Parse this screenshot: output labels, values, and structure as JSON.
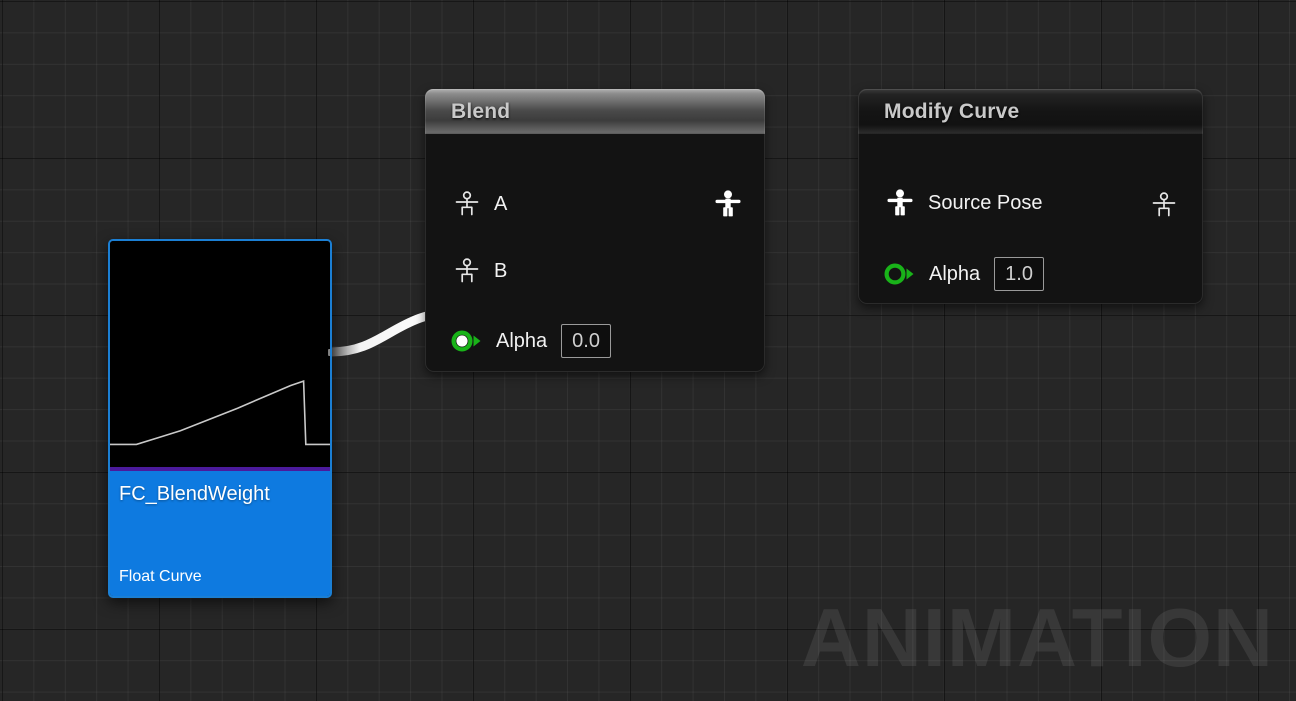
{
  "canvas": {
    "watermark": "ANIMATION",
    "background_color": "#262626",
    "grid_major_color": "#000000",
    "grid_minor_color": "#2f2f2f"
  },
  "nodes": {
    "blend": {
      "title": "Blend",
      "header_style": "light",
      "inputs": [
        {
          "label": "A",
          "pin_type": "pose",
          "connected": false,
          "value": null
        },
        {
          "label": "B",
          "pin_type": "pose",
          "connected": false,
          "value": null
        },
        {
          "label": "Alpha",
          "pin_type": "float",
          "connected": true,
          "value": "0.0"
        }
      ],
      "outputs": [
        {
          "label": "",
          "pin_type": "pose",
          "connected": true
        }
      ]
    },
    "modify_curve": {
      "title": "Modify Curve",
      "header_style": "dark",
      "inputs": [
        {
          "label": "Source Pose",
          "pin_type": "pose",
          "connected": true,
          "value": null
        },
        {
          "label": "Alpha",
          "pin_type": "float",
          "connected": false,
          "value": "1.0"
        }
      ],
      "outputs": [
        {
          "label": "",
          "pin_type": "pose",
          "connected": false
        }
      ]
    },
    "float_curve_asset": {
      "name": "FC_BlendWeight",
      "type_label": "Float Curve",
      "selected": true,
      "accent_color": "#0e7ae0",
      "divider_color": "#4b1a9c",
      "selection_color": "#1b7fd4",
      "thumbnail": {
        "type": "line",
        "background": "#000000",
        "line_color": "#c9c9c9",
        "description": "float curve preview: flat low value rising gradually then dropping sharply near end",
        "points": [
          [
            0.0,
            0.1
          ],
          [
            0.12,
            0.1
          ],
          [
            0.22,
            0.13
          ],
          [
            0.32,
            0.16
          ],
          [
            0.45,
            0.21
          ],
          [
            0.58,
            0.26
          ],
          [
            0.7,
            0.31
          ],
          [
            0.82,
            0.36
          ],
          [
            0.88,
            0.38
          ],
          [
            0.89,
            0.1
          ],
          [
            1.0,
            0.1
          ]
        ]
      }
    }
  },
  "connections": [
    {
      "from": "float_curve_asset.output",
      "to": "blend.Alpha",
      "color": "#ffffff",
      "style": "thick"
    },
    {
      "from": "blend.output",
      "to": "modify_curve.Source Pose",
      "color": "#a8a8a8",
      "style": "thin"
    }
  ]
}
